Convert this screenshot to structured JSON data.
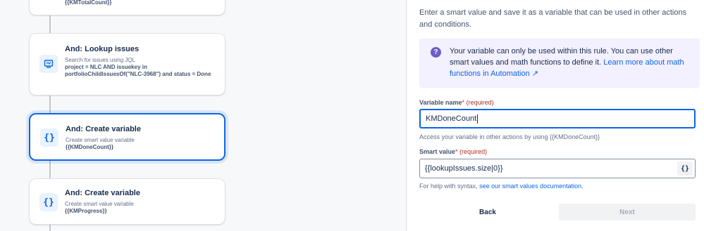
{
  "flow": {
    "top_card": {
      "value": "{{KMTotalCount}}"
    },
    "cards": [
      {
        "title": "And: Lookup issues",
        "subtitle": "Search for issues using JQL",
        "value": "project = NLC AND issuekey in portfolioChildIssuesOf(\"NLC-3968\") and status = Done",
        "icon": "lookup-issues-icon"
      },
      {
        "title": "And: Create variable",
        "subtitle": "Create smart value variable",
        "value": "{{KMDoneCount}}",
        "icon": "curly-braces-icon",
        "selected": true
      },
      {
        "title": "And: Create variable",
        "subtitle": "Create smart value variable",
        "value": "{{KMProgress}}",
        "icon": "curly-braces-icon"
      }
    ]
  },
  "panel": {
    "intro": "Enter a smart value and save it as a variable that can be used in other actions and conditions.",
    "info_text": "Your variable can only be used within this rule. You can use other smart values and math functions to define it.",
    "info_link": "Learn more about math functions in Automation ↗",
    "variable_name": {
      "label": "Variable name",
      "required": "(required)",
      "value": "KMDoneCount",
      "helper": "Access your variable in other actions by using {{KMDoneCount}}"
    },
    "smart_value": {
      "label": "Smart value",
      "required": "(required)",
      "value": "{{lookupIssues.size|0}}",
      "braces_button": "{}",
      "helper_prefix": "For help with syntax,",
      "helper_link": "see our smart values documentation."
    },
    "back_label": "Back",
    "next_label": "Next"
  },
  "colors": {
    "accent": "#0c66e4",
    "info_bg": "#f3f0ff",
    "required": "#ae2e24"
  }
}
